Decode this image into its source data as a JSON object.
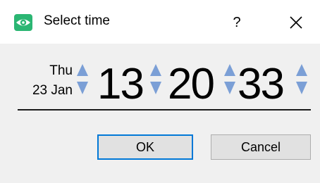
{
  "window": {
    "title": "Select time",
    "help_label": "?",
    "icon": "eye-icon",
    "close_icon": "close-icon",
    "accent_color": "#0078d7",
    "icon_color": "#2bb673"
  },
  "picker": {
    "day": "Thu",
    "date": "23 Jan",
    "hours": "13",
    "minutes": "20",
    "seconds": "33",
    "spin_arrow_color": "#7b9fd6"
  },
  "buttons": {
    "ok_label": "OK",
    "cancel_label": "Cancel"
  }
}
